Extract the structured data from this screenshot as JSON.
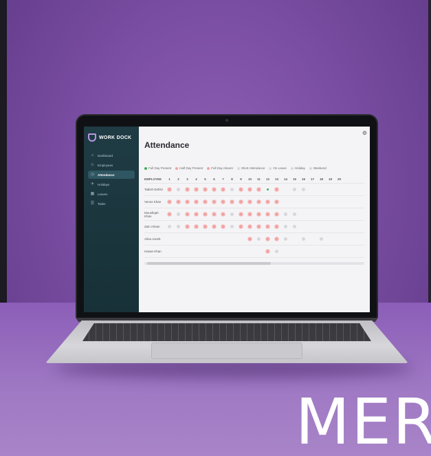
{
  "app": {
    "brand": "WORK DOCK",
    "page_title": "Attendance",
    "settings_icon": "gear-icon"
  },
  "sidebar": {
    "items": [
      {
        "label": "Dashboard",
        "icon": "home-icon",
        "active": false
      },
      {
        "label": "Employees",
        "icon": "users-icon",
        "active": false
      },
      {
        "label": "Attendance",
        "icon": "clock-icon",
        "active": true
      },
      {
        "label": "Holidays",
        "icon": "plane-icon",
        "active": false
      },
      {
        "label": "Leaves",
        "icon": "calendar-icon",
        "active": false
      },
      {
        "label": "Tasks",
        "icon": "tasks-icon",
        "active": false
      }
    ]
  },
  "legend": [
    {
      "label": "Full Day Present",
      "color": "#3fae62"
    },
    {
      "label": "Half Day Present",
      "color": "#f2a3a3"
    },
    {
      "label": "Full Day Absent",
      "color": "#f2a3a3"
    },
    {
      "label": "Short Attendance",
      "color": "#d7d7dc"
    },
    {
      "label": "On Leave",
      "color": "#d7d7dc"
    },
    {
      "label": "Holiday",
      "color": "#d7d7dc"
    },
    {
      "label": "Weekend",
      "color": "#d7d7dc"
    }
  ],
  "table": {
    "employee_header": "EMPLOYEE",
    "days": [
      "1",
      "2",
      "3",
      "4",
      "5",
      "6",
      "7",
      "8",
      "9",
      "10",
      "11",
      "12",
      "13",
      "14",
      "15",
      "16",
      "17",
      "18",
      "19",
      "20"
    ],
    "rows": [
      {
        "name": "Tabish Dehlvi",
        "marks": [
          "abs",
          "wk",
          "abs",
          "abs",
          "abs",
          "abs",
          "abs",
          "wk",
          "abs",
          "abs",
          "abs",
          "green",
          "abs",
          "none",
          "wk",
          "wk",
          "none",
          "none",
          "none",
          "none"
        ]
      },
      {
        "name": "Venus Khan",
        "marks": [
          "abs",
          "abs",
          "abs",
          "abs",
          "abs",
          "abs",
          "abs",
          "abs",
          "abs",
          "abs",
          "abs",
          "abs",
          "abs",
          "none",
          "none",
          "none",
          "none",
          "none",
          "none",
          "none"
        ]
      },
      {
        "name": "Mousfiqah Khan",
        "marks": [
          "abs",
          "wk",
          "abs",
          "abs",
          "abs",
          "abs",
          "abs",
          "wk",
          "abs",
          "abs",
          "abs",
          "abs",
          "abs",
          "wk",
          "wk",
          "none",
          "none",
          "none",
          "none",
          "none"
        ]
      },
      {
        "name": "Zain Ahsan",
        "marks": [
          "wk",
          "wk",
          "abs",
          "abs",
          "abs",
          "abs",
          "abs",
          "wk",
          "abs",
          "abs",
          "abs",
          "abs",
          "abs",
          "wk",
          "wk",
          "none",
          "none",
          "none",
          "none",
          "none"
        ]
      },
      {
        "name": "Alina Joneb",
        "marks": [
          "none",
          "none",
          "none",
          "none",
          "none",
          "none",
          "none",
          "none",
          "none",
          "abs",
          "wk",
          "abs",
          "abs",
          "wk",
          "none",
          "wk",
          "none",
          "wk",
          "none",
          "none"
        ]
      },
      {
        "name": "Hasan Khan",
        "marks": [
          "none",
          "none",
          "none",
          "none",
          "none",
          "none",
          "none",
          "none",
          "none",
          "none",
          "none",
          "abs",
          "wk",
          "none",
          "none",
          "none",
          "none",
          "none",
          "none",
          "none"
        ]
      }
    ]
  },
  "overlay_text": "MER"
}
